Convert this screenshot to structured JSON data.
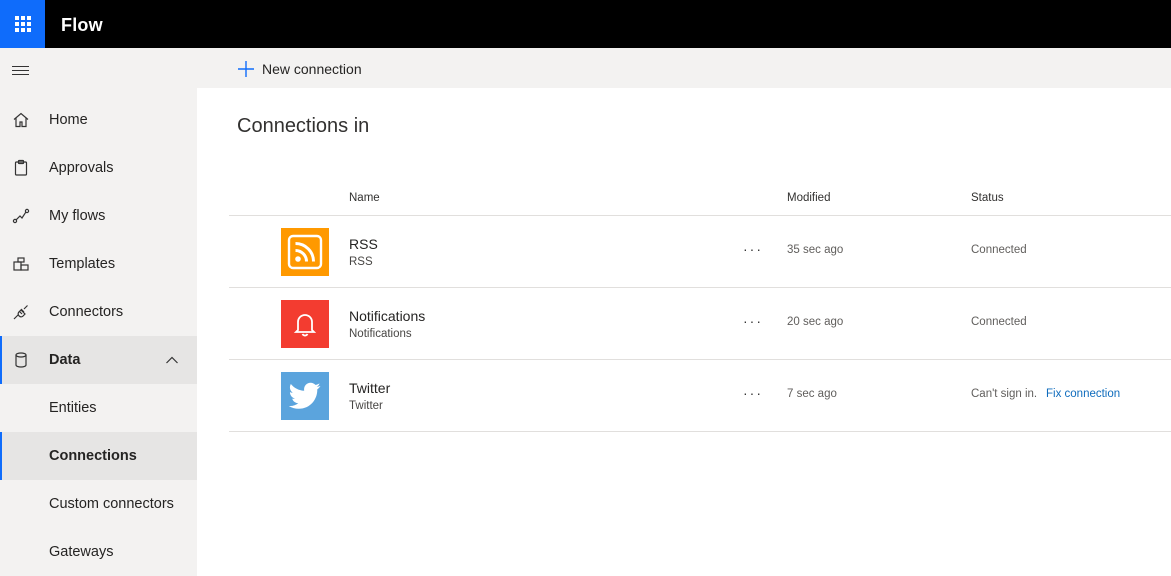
{
  "app": {
    "title": "Flow"
  },
  "sidebar": {
    "items": [
      {
        "label": "Home",
        "icon": "home-icon"
      },
      {
        "label": "Approvals",
        "icon": "clipboard-icon"
      },
      {
        "label": "My flows",
        "icon": "flow-icon"
      },
      {
        "label": "Templates",
        "icon": "templates-icon"
      },
      {
        "label": "Connectors",
        "icon": "plug-icon"
      },
      {
        "label": "Data",
        "icon": "database-icon"
      },
      {
        "label": "Entities"
      },
      {
        "label": "Connections"
      },
      {
        "label": "Custom connectors"
      },
      {
        "label": "Gateways"
      }
    ],
    "active_item": "Connections",
    "expanded_section": "Data"
  },
  "toolbar": {
    "new_connection_label": "New connection"
  },
  "page": {
    "title": "Connections in"
  },
  "table": {
    "headers": {
      "name": "Name",
      "modified": "Modified",
      "status": "Status"
    },
    "rows": [
      {
        "name": "RSS",
        "subtitle": "RSS",
        "more": "···",
        "modified": "35 sec ago",
        "status": "Connected",
        "tile_color": "#ff9900",
        "icon": "rss-icon"
      },
      {
        "name": "Notifications",
        "subtitle": "Notifications",
        "more": "···",
        "modified": "20 sec ago",
        "status": "Connected",
        "tile_color": "#f33c30",
        "icon": "bell-icon"
      },
      {
        "name": "Twitter",
        "subtitle": "Twitter",
        "more": "···",
        "modified": "7 sec ago",
        "status": "Can't sign in.",
        "action": "Fix connection",
        "tile_color": "#5ba4dd",
        "icon": "twitter-bird-icon"
      }
    ]
  },
  "colors": {
    "accent": "#0f6cfb",
    "topbar": "#000000",
    "sidebar": "#f3f2f1",
    "link": "#0f6cbd"
  }
}
